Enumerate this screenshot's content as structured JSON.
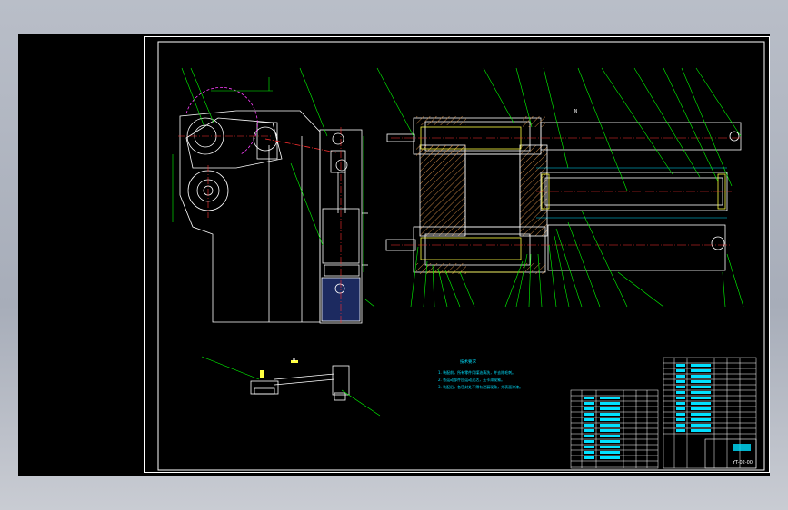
{
  "drawing": {
    "background": "#000000",
    "line_color": "#ffffff",
    "leader_color": "#00ff00",
    "centerline_color": "#ff3030",
    "dimension_color": "#00e0ff",
    "circle_color": "#ff40ff",
    "view_label": "N",
    "drawing_code": "YT-02-00",
    "notes": {
      "title": "技术要求",
      "lines": [
        "1. 装配前，所有零件用煤油清洗，并去除毛刺。",
        "2. 各运动部件应运动灵活，无卡滞现象。",
        "3. 装配后，各密封处不得有泄漏现象，外表面涂漆。"
      ]
    }
  },
  "icons": {
    "view_marker": "view-arrow-icon"
  }
}
